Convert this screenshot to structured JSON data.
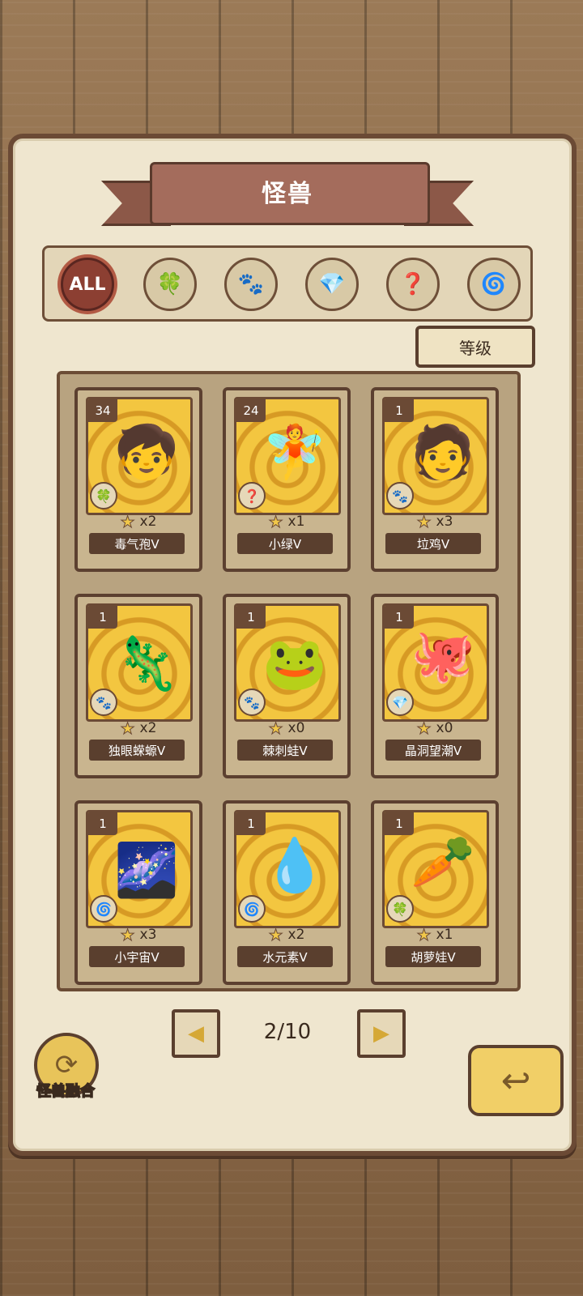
{
  "header": {
    "title": "怪兽"
  },
  "filters": {
    "items": [
      {
        "label": "ALL",
        "icon": "all-icon",
        "active": true
      },
      {
        "label": "",
        "icon": "leaf-icon",
        "glyph": "🍀"
      },
      {
        "label": "",
        "icon": "paw-icon",
        "glyph": "🐾"
      },
      {
        "label": "",
        "icon": "crystal-icon",
        "glyph": "💎"
      },
      {
        "label": "",
        "icon": "question-icon",
        "glyph": "❓"
      },
      {
        "label": "",
        "icon": "swirl-icon",
        "glyph": "🌀"
      }
    ]
  },
  "sort": {
    "label": "等级"
  },
  "cards": [
    {
      "level": "34",
      "count": "x2",
      "name": "毒气孢V",
      "type_icon": "leaf-icon",
      "type_glyph": "🍀",
      "monster": "🧒"
    },
    {
      "level": "24",
      "count": "x1",
      "name": "小绿V",
      "type_icon": "question-icon",
      "type_glyph": "❓",
      "monster": "🧚"
    },
    {
      "level": "1",
      "count": "x3",
      "name": "垃鸡V",
      "type_icon": "paw-icon",
      "type_glyph": "🐾",
      "monster": "🧑"
    },
    {
      "level": "1",
      "count": "x2",
      "name": "独眼蝾螈V",
      "type_icon": "paw-icon",
      "type_glyph": "🐾",
      "monster": "🦎"
    },
    {
      "level": "1",
      "count": "x0",
      "name": "棘刺蛙V",
      "type_icon": "paw-icon",
      "type_glyph": "🐾",
      "monster": "🐸"
    },
    {
      "level": "1",
      "count": "x0",
      "name": "晶洞望潮V",
      "type_icon": "crystal-icon",
      "type_glyph": "💎",
      "monster": "🐙"
    },
    {
      "level": "1",
      "count": "x3",
      "name": "小宇宙V",
      "type_icon": "swirl-icon",
      "type_glyph": "🌀",
      "monster": "🌌"
    },
    {
      "level": "1",
      "count": "x2",
      "name": "水元素V",
      "type_icon": "swirl-icon",
      "type_glyph": "🌀",
      "monster": "💧"
    },
    {
      "level": "1",
      "count": "x1",
      "name": "胡萝娃V",
      "type_icon": "leaf-icon",
      "type_glyph": "🍀",
      "monster": "🥕"
    }
  ],
  "pagination": {
    "current": "2/10",
    "prev_glyph": "◀",
    "next_glyph": "▶"
  },
  "fusion": {
    "label": "怪兽融合",
    "glyph": "⟳"
  },
  "back": {
    "glyph": "↩"
  },
  "colors": {
    "accent": "#8c3f32",
    "paper": "#efe6cf",
    "frame": "#5a3f2e",
    "card_gold": "#f3c640"
  }
}
